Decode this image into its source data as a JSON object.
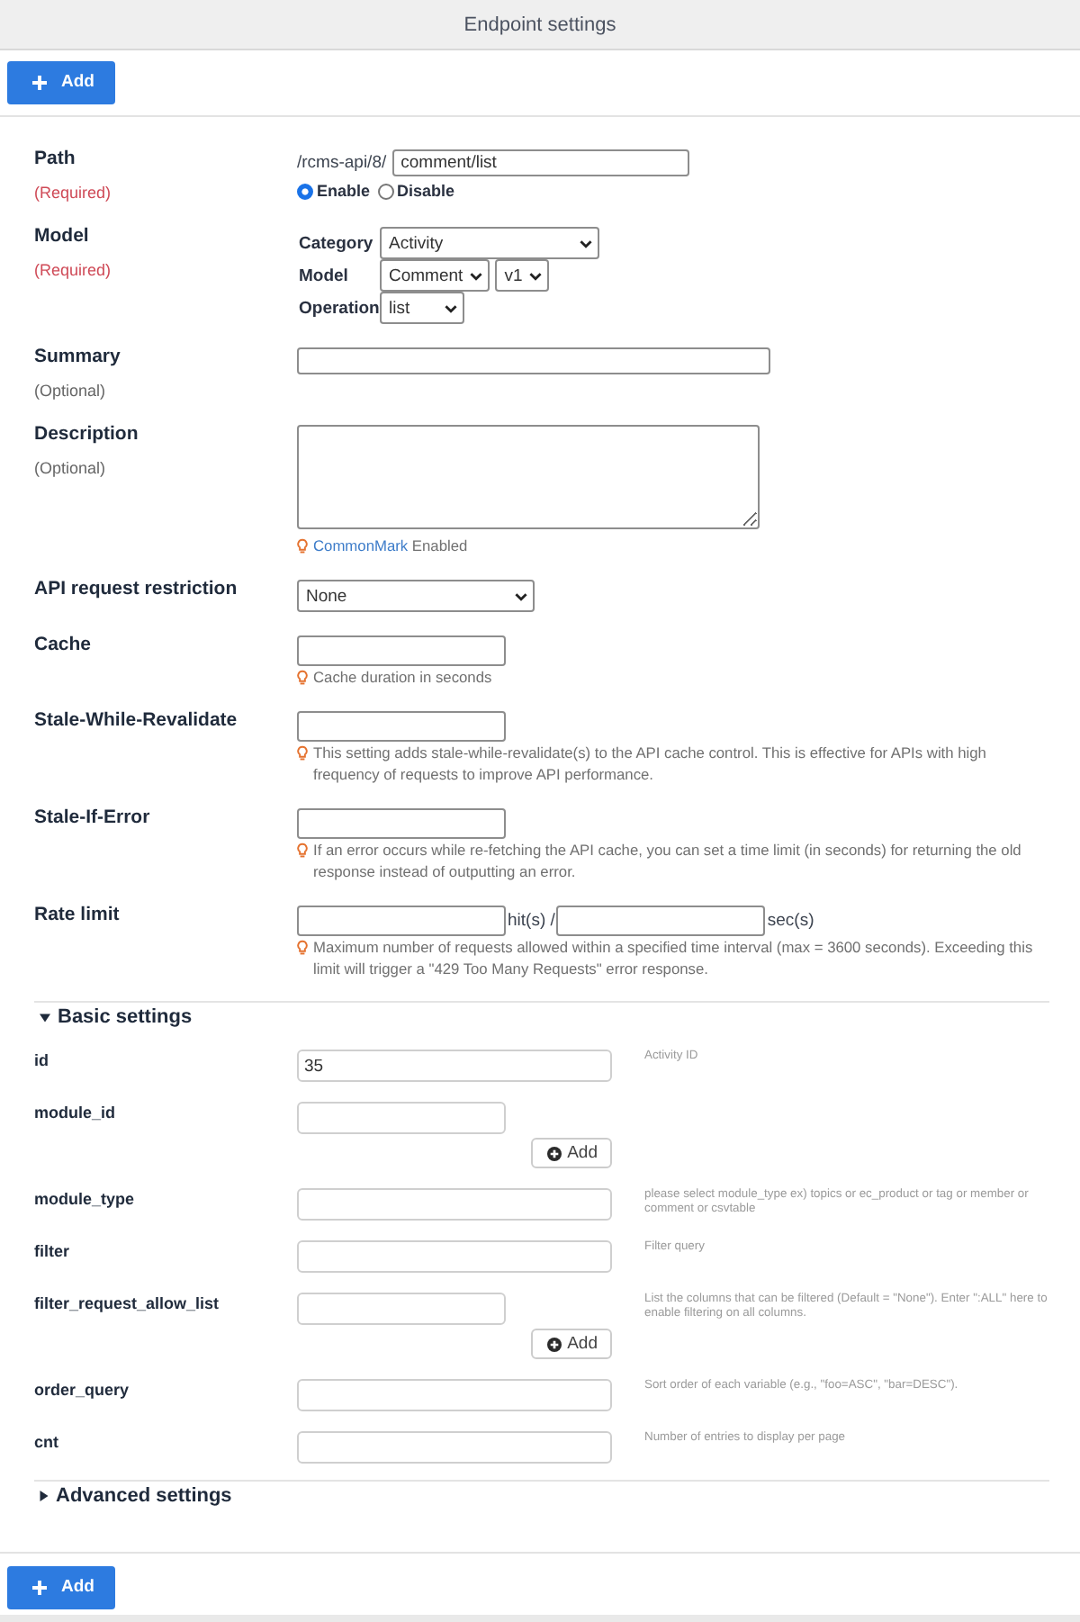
{
  "window": {
    "title": "Endpoint settings"
  },
  "top_actions": [
    {
      "label": "Add"
    }
  ],
  "fields": [
    {
      "kind": "path",
      "label": "Path",
      "note": "(Required)",
      "required": true,
      "prefix": "/rcms-api/8/",
      "value": "comment/list",
      "status_options": [
        {
          "label": "Enable",
          "selected": true
        },
        {
          "label": "Disable",
          "selected": false
        }
      ]
    },
    {
      "kind": "model",
      "label": "Model",
      "note": "(Required)",
      "required": true,
      "rows": [
        {
          "label": "Category",
          "selects": [
            "Activity"
          ]
        },
        {
          "label": "Model",
          "selects": [
            "Comment",
            "v1"
          ]
        },
        {
          "label": "Operation",
          "selects": [
            "list"
          ]
        }
      ]
    },
    {
      "kind": "text",
      "label": "Summary",
      "note": "(Optional)",
      "required": false
    },
    {
      "kind": "textarea",
      "label": "Description",
      "note": "(Optional)",
      "required": false,
      "hint_link": "CommonMark",
      "hint": "Enabled"
    },
    {
      "kind": "select",
      "label": "API request restriction",
      "value": "None"
    },
    {
      "kind": "number",
      "label": "Cache",
      "hint": "Cache duration in seconds"
    },
    {
      "kind": "number",
      "label": "Stale-While-Revalidate",
      "hint": "This setting adds stale-while-revalidate(s) to the API cache control. This is effective for APIs with high frequency of requests to improve API performance."
    },
    {
      "kind": "number",
      "label": "Stale-If-Error",
      "hint": "If an error occurs while re-fetching the API cache, you can set a time limit (in seconds) for returning the old response instead of outputting an error."
    },
    {
      "kind": "rate",
      "label": "Rate limit",
      "unit_1": "hit(s) /",
      "unit_2": "sec(s)",
      "hint": "Maximum number of requests allowed within a specified time interval (max = 3600 seconds). Exceeding this limit will trigger a \"429 Too Many Requests\" error response."
    }
  ],
  "sections": [
    {
      "title": "Basic settings",
      "expanded": true,
      "fields": [
        {
          "kind": "text",
          "label": "id",
          "value": "35",
          "hint": "Activity ID"
        },
        {
          "kind": "list",
          "label": "module_id",
          "add_label": "Add"
        },
        {
          "kind": "text",
          "label": "module_type",
          "hint": "please select module_type ex) topics or ec_product or tag or member or comment or csvtable"
        },
        {
          "kind": "text",
          "label": "filter",
          "hint": "Filter query"
        },
        {
          "kind": "list",
          "label": "filter_request_allow_list",
          "add_label": "Add",
          "hint": "List the columns that can be filtered (Default = \"None\"). Enter \":ALL\" here to enable filtering on all columns."
        },
        {
          "kind": "text",
          "label": "order_query",
          "hint": "Sort order of each variable (e.g., \"foo=ASC\", \"bar=DESC\")."
        },
        {
          "kind": "text",
          "label": "cnt",
          "hint": "Number of entries to display per page"
        }
      ]
    },
    {
      "title": "Advanced settings",
      "expanded": false
    }
  ],
  "bottom_actions": [
    {
      "label": "Add"
    }
  ]
}
